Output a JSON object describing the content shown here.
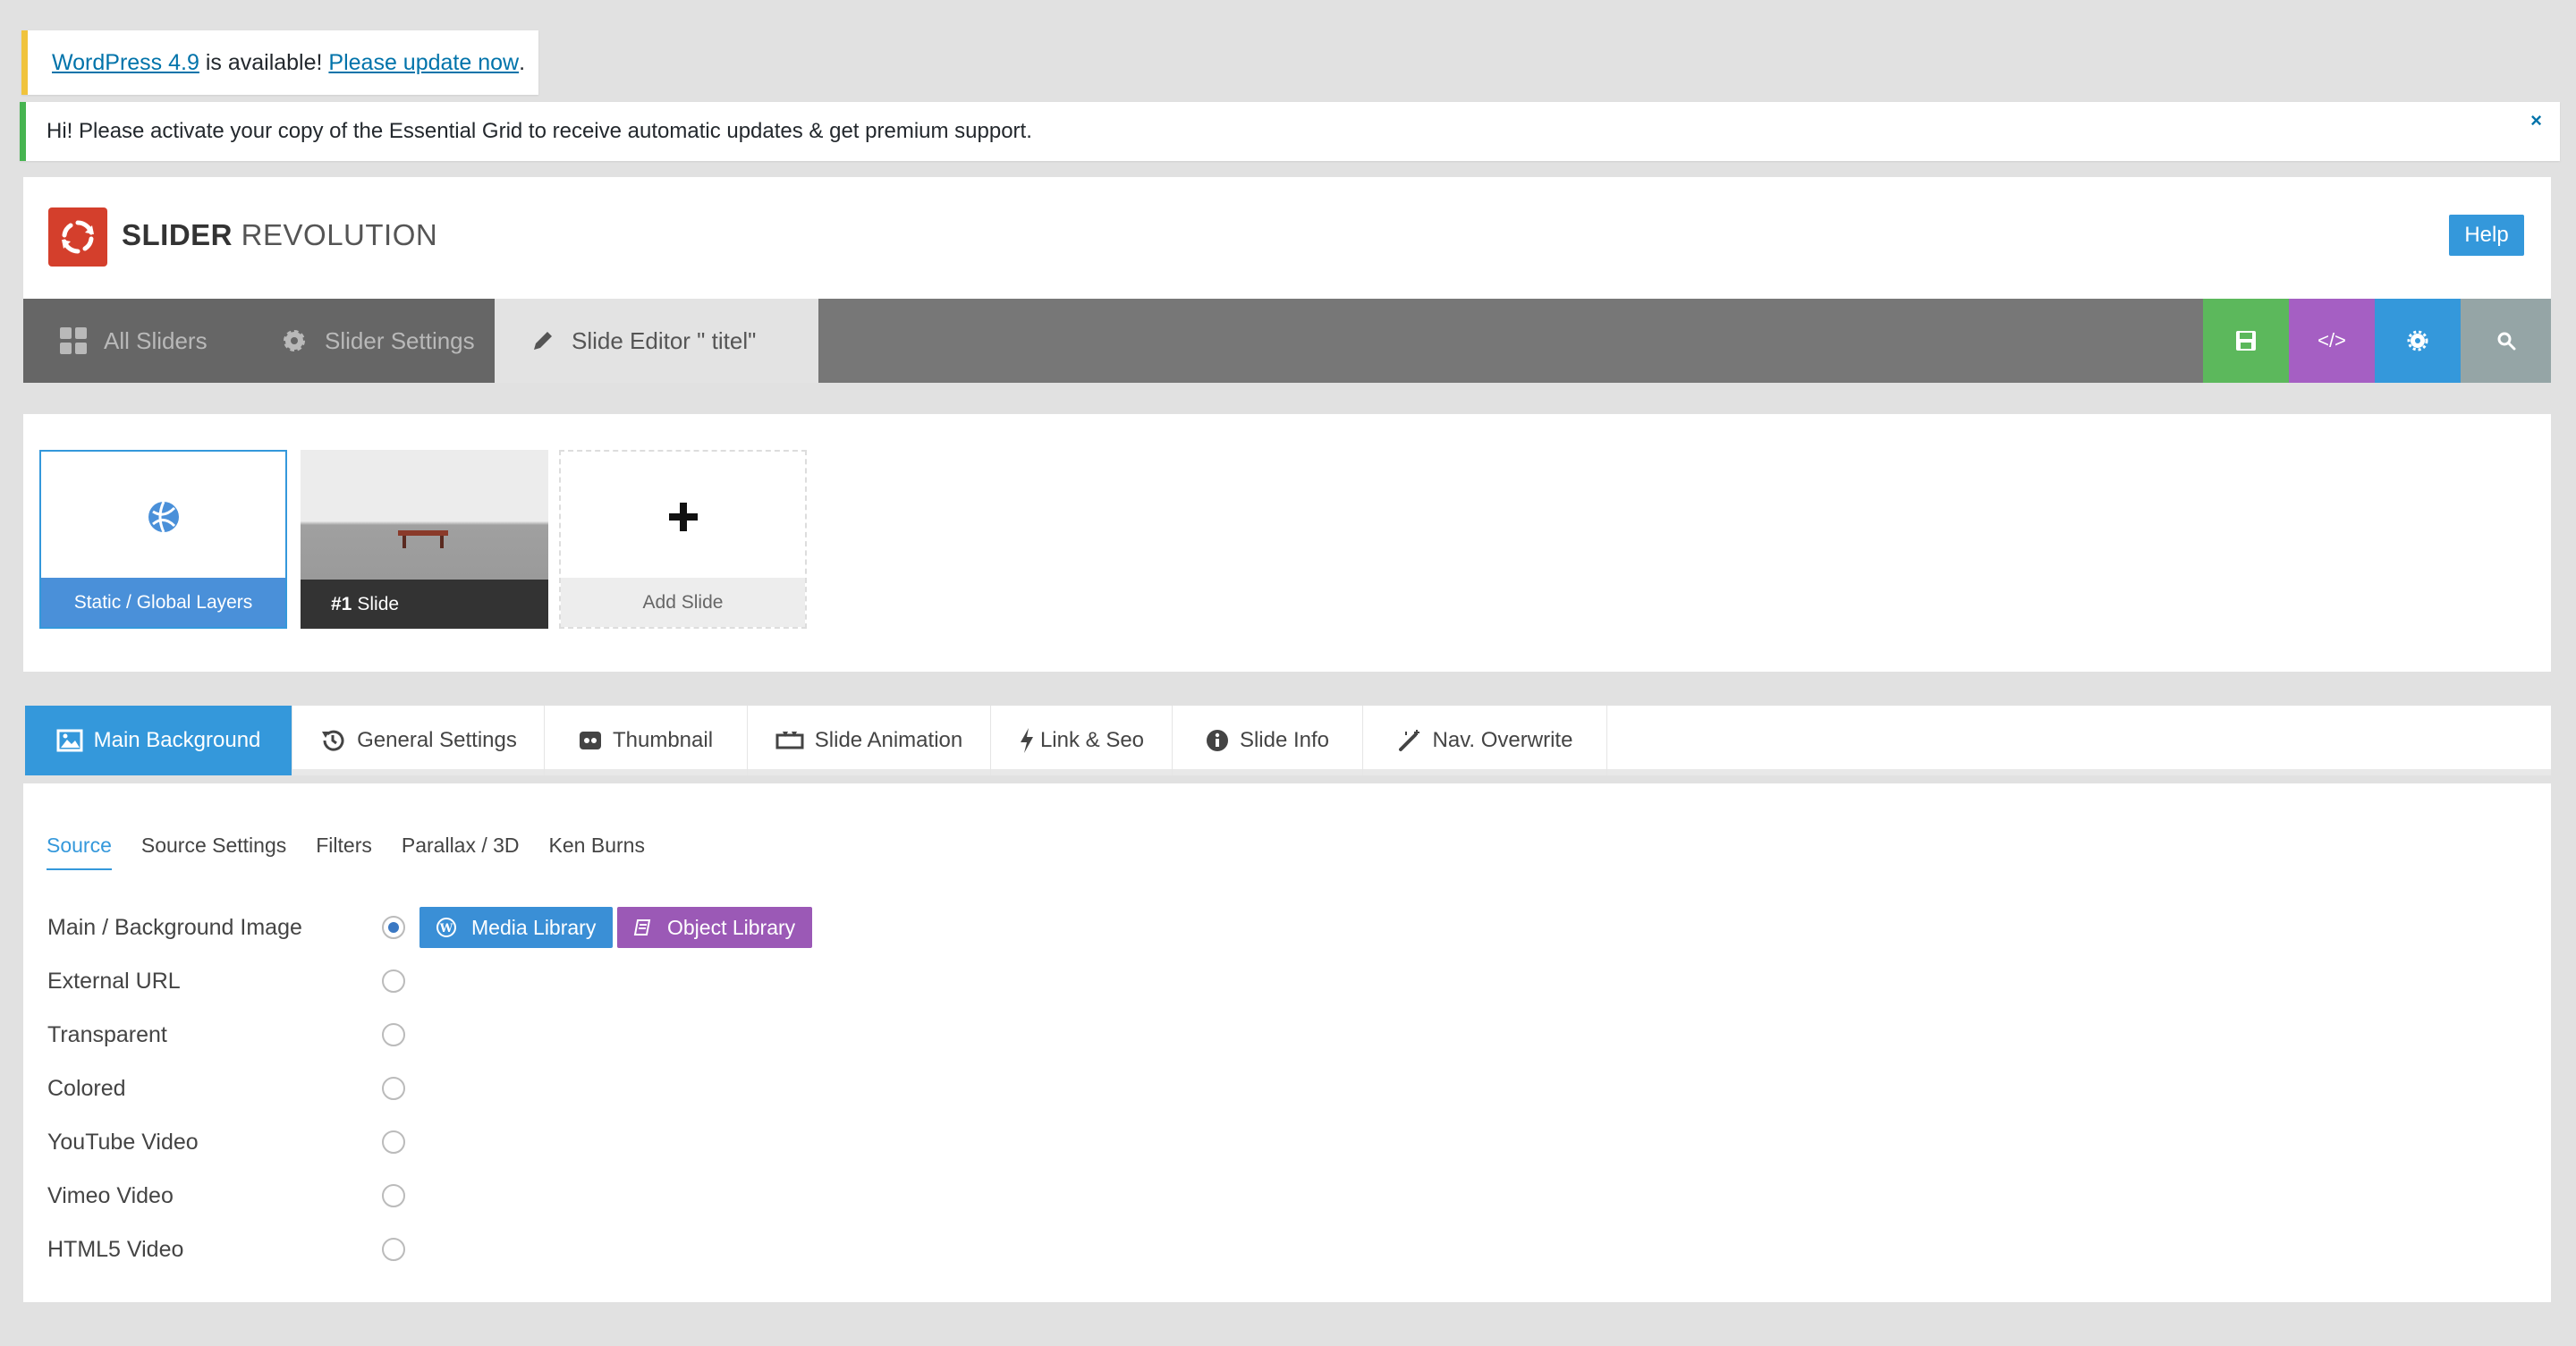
{
  "notices": {
    "update": {
      "link_version": "WordPress 4.9",
      "middle": " is available! ",
      "link_update": "Please update now",
      "end": "."
    },
    "activate": {
      "text": "Hi! Please activate your copy of the Essential Grid to receive automatic updates & get premium support.",
      "close": "×"
    }
  },
  "header": {
    "brand_bold": "SLIDER",
    "brand_light": " REVOLUTION",
    "help_label": "Help"
  },
  "topnav": {
    "tabs": [
      {
        "label": "All Sliders",
        "icon": "grid-icon"
      },
      {
        "label": "Slider Settings",
        "icon": "gear-icon"
      },
      {
        "label": "Slide Editor \" titel\"",
        "icon": "pencil-icon"
      }
    ],
    "actions": [
      {
        "name": "save",
        "icon": "floppy-icon",
        "color": "#5cb85c"
      },
      {
        "name": "embed",
        "icon": "code-icon",
        "glyph": "</>",
        "color": "#a55fc3"
      },
      {
        "name": "settings",
        "icon": "gear-icon",
        "color": "#3498db"
      },
      {
        "name": "preview",
        "icon": "search-icon",
        "color": "#95a5a6"
      }
    ]
  },
  "slides": {
    "static_label": "Static / Global Layers",
    "slide1_number": "#1",
    "slide1_label": "Slide",
    "add_label": "Add Slide"
  },
  "settings_tabs": [
    {
      "label": "Main Background",
      "icon": "image-icon"
    },
    {
      "label": "General Settings",
      "icon": "history-icon"
    },
    {
      "label": "Thumbnail",
      "icon": "thumbnail-icon"
    },
    {
      "label": "Slide Animation",
      "icon": "animation-icon"
    },
    {
      "label": "Link & Seo",
      "icon": "bolt-icon"
    },
    {
      "label": "Slide Info",
      "icon": "info-icon"
    },
    {
      "label": "Nav. Overwrite",
      "icon": "magic-wand-icon"
    }
  ],
  "subtabs": [
    "Source",
    "Source Settings",
    "Filters",
    "Parallax / 3D",
    "Ken Burns"
  ],
  "source_options": [
    {
      "label": "Main / Background Image",
      "checked": true
    },
    {
      "label": "External URL",
      "checked": false
    },
    {
      "label": "Transparent",
      "checked": false
    },
    {
      "label": "Colored",
      "checked": false
    },
    {
      "label": "YouTube Video",
      "checked": false
    },
    {
      "label": "Vimeo Video",
      "checked": false
    },
    {
      "label": "HTML5 Video",
      "checked": false
    }
  ],
  "library_buttons": {
    "media": "Media Library",
    "object": "Object Library"
  },
  "colors": {
    "accent": "#3498db",
    "purple": "#9b59b6",
    "green": "#5cb85c",
    "brand_red": "#d43f2c"
  }
}
